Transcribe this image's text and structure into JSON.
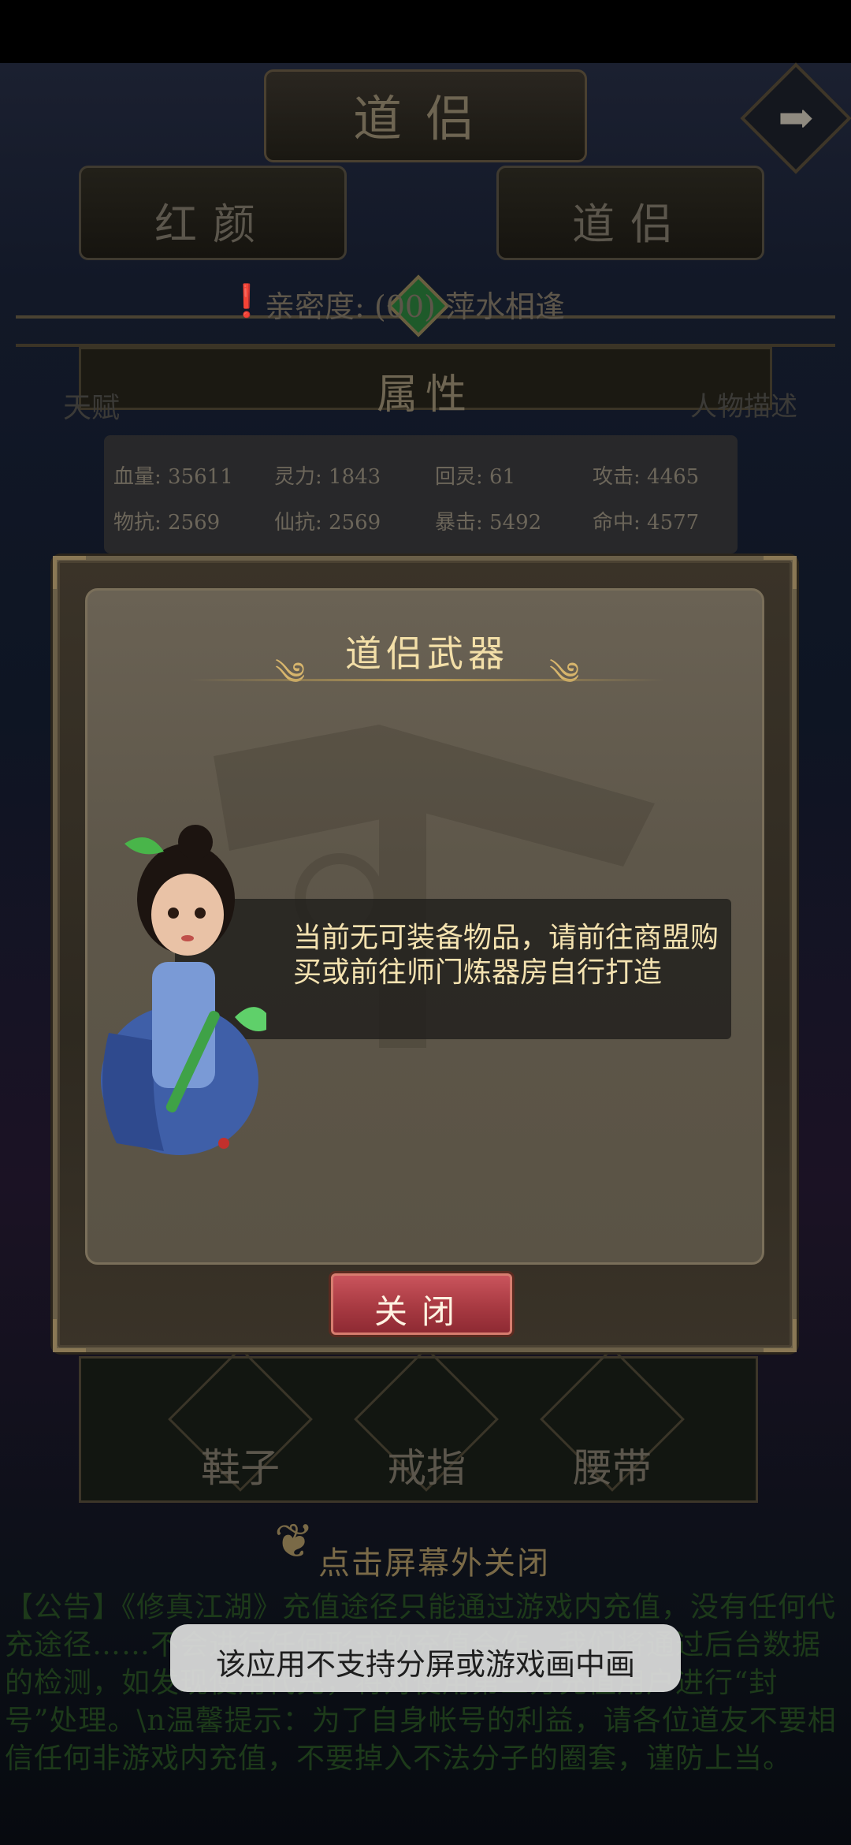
{
  "background": {
    "title": "道侣",
    "tabs": [
      "红颜",
      "道侣"
    ],
    "intimacy_text": "亲密度: (00) 萍水相逢",
    "attributes_title": "属性",
    "left_label": "天赋",
    "right_label": "人物描述",
    "stats": [
      {
        "label": "血量: 35611"
      },
      {
        "label": "灵力: 1843"
      },
      {
        "label": "回灵: 61"
      },
      {
        "label": "攻击: 4465"
      },
      {
        "label": "物抗: 2569"
      },
      {
        "label": "仙抗: 2569"
      },
      {
        "label": "暴击: 5492"
      },
      {
        "label": "命中: 4577"
      }
    ],
    "slots": [
      "鞋子",
      "戒指",
      "腰带"
    ],
    "hint": "点击屏幕外关闭",
    "notice": "【公告】《修真江湖》充值途径只能通过游戏内充值，没有任何代充途径……不会进行任何形式的充值合作。我们将通过后台数据的检测，如发现使用代充，将对使用第三方充值用户进行“封号”处理。\\n温馨提示：为了自身帐号的利益，请各位道友不要相信任何非游戏内充值，不要掉入不法分子的圈套，谨防上当。"
  },
  "modal": {
    "title": "道侣武器",
    "message": "当前无可装备物品，请前往商盟购买或前往师门炼器房自行打造",
    "close_label": "关闭"
  },
  "toast": {
    "text": "该应用不支持分屏或游戏画中画"
  },
  "colors": {
    "title_gold": "#f3dfa8",
    "close_red": "#b4434b",
    "toast_bg": "#dedede"
  }
}
